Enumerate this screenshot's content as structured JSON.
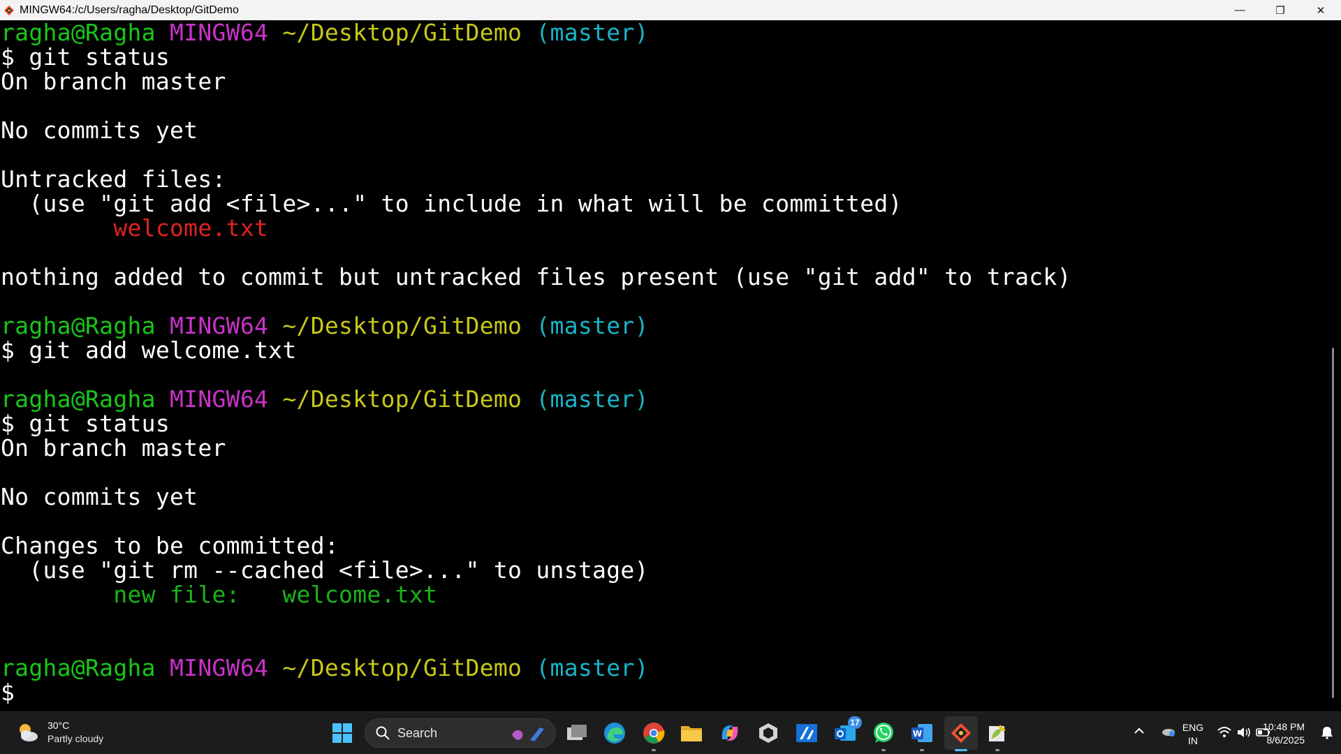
{
  "window": {
    "title": "MINGW64:/c/Users/ragha/Desktop/GitDemo",
    "controls": {
      "minimize": "—",
      "restore": "❐",
      "close": "✕"
    }
  },
  "terminal": {
    "lines": [
      [
        {
          "t": "ragha@Ragha ",
          "c": "green"
        },
        {
          "t": "MINGW64 ",
          "c": "purple"
        },
        {
          "t": "~/Desktop/GitDemo ",
          "c": "yellow"
        },
        {
          "t": "(master)",
          "c": "cyan"
        }
      ],
      [
        {
          "t": "$ git status",
          "c": "white"
        }
      ],
      [
        {
          "t": "On branch master",
          "c": "white"
        }
      ],
      [
        {
          "t": "",
          "c": "white"
        }
      ],
      [
        {
          "t": "No commits yet",
          "c": "white"
        }
      ],
      [
        {
          "t": "",
          "c": "white"
        }
      ],
      [
        {
          "t": "Untracked files:",
          "c": "white"
        }
      ],
      [
        {
          "t": "  (use \"git add <file>...\" to include in what will be committed)",
          "c": "white"
        }
      ],
      [
        {
          "t": "        ",
          "c": "white"
        },
        {
          "t": "welcome.txt",
          "c": "red"
        }
      ],
      [
        {
          "t": "",
          "c": "white"
        }
      ],
      [
        {
          "t": "nothing added to commit but untracked files present (use \"git add\" to track)",
          "c": "white"
        }
      ],
      [
        {
          "t": "",
          "c": "white"
        }
      ],
      [
        {
          "t": "ragha@Ragha ",
          "c": "green"
        },
        {
          "t": "MINGW64 ",
          "c": "purple"
        },
        {
          "t": "~/Desktop/GitDemo ",
          "c": "yellow"
        },
        {
          "t": "(master)",
          "c": "cyan"
        }
      ],
      [
        {
          "t": "$ git add welcome.txt",
          "c": "white"
        }
      ],
      [
        {
          "t": "",
          "c": "white"
        }
      ],
      [
        {
          "t": "ragha@Ragha ",
          "c": "green"
        },
        {
          "t": "MINGW64 ",
          "c": "purple"
        },
        {
          "t": "~/Desktop/GitDemo ",
          "c": "yellow"
        },
        {
          "t": "(master)",
          "c": "cyan"
        }
      ],
      [
        {
          "t": "$ git status",
          "c": "white"
        }
      ],
      [
        {
          "t": "On branch master",
          "c": "white"
        }
      ],
      [
        {
          "t": "",
          "c": "white"
        }
      ],
      [
        {
          "t": "No commits yet",
          "c": "white"
        }
      ],
      [
        {
          "t": "",
          "c": "white"
        }
      ],
      [
        {
          "t": "Changes to be committed:",
          "c": "white"
        }
      ],
      [
        {
          "t": "  (use \"git rm --cached <file>...\" to unstage)",
          "c": "white"
        }
      ],
      [
        {
          "t": "        ",
          "c": "white"
        },
        {
          "t": "new file:   welcome.txt",
          "c": "dgreen"
        }
      ],
      [
        {
          "t": "",
          "c": "white"
        }
      ],
      [
        {
          "t": "",
          "c": "white"
        }
      ],
      [
        {
          "t": "ragha@Ragha ",
          "c": "green"
        },
        {
          "t": "MINGW64 ",
          "c": "purple"
        },
        {
          "t": "~/Desktop/GitDemo ",
          "c": "yellow"
        },
        {
          "t": "(master)",
          "c": "cyan"
        }
      ],
      [
        {
          "t": "$",
          "c": "white"
        }
      ]
    ],
    "colors": {
      "green": "#19c719",
      "purple": "#c833c8",
      "yellow": "#c8c819",
      "cyan": "#19b4c8",
      "red": "#e02222",
      "dgreen": "#19b419",
      "white": "#ffffff"
    }
  },
  "taskbar": {
    "weather": {
      "temp": "30°C",
      "desc": "Partly cloudy",
      "icon": "partly-cloudy-icon"
    },
    "search": {
      "label": "Search"
    },
    "apps": [
      {
        "name": "task-view-icon"
      },
      {
        "name": "edge-icon"
      },
      {
        "name": "chrome-icon"
      },
      {
        "name": "file-explorer-icon"
      },
      {
        "name": "copilot-icon"
      },
      {
        "name": "unity-icon"
      },
      {
        "name": "azure-icon"
      },
      {
        "name": "outlook-icon",
        "badge": "17"
      },
      {
        "name": "whatsapp-icon"
      },
      {
        "name": "word-icon"
      },
      {
        "name": "git-bash-icon"
      },
      {
        "name": "notepad-plus-icon"
      }
    ],
    "tray": {
      "lang_top": "ENG",
      "lang_bottom": "IN",
      "time": "10:48 PM",
      "date": "8/6/2025"
    }
  }
}
